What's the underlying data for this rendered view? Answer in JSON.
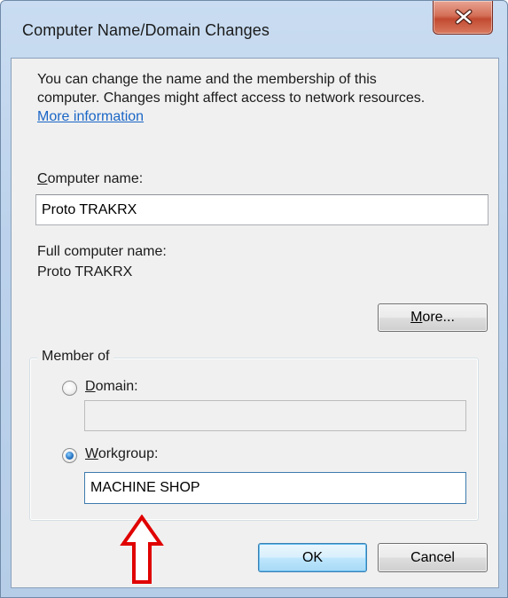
{
  "window": {
    "title": "Computer Name/Domain Changes",
    "close_glyph": "close-icon"
  },
  "intro": {
    "line1": "You can change the name and the membership of this",
    "line2": "computer. Changes might affect access to network resources.",
    "more_info_link": "More information"
  },
  "computer_name": {
    "label_accel": "C",
    "label_rest": "omputer name:",
    "value": "Proto TRAKRX"
  },
  "full_name": {
    "label": "Full computer name:",
    "value": "Proto TRAKRX"
  },
  "more_button": {
    "accel": "M",
    "rest": "ore..."
  },
  "member_of": {
    "legend": "Member of",
    "domain": {
      "label_accel": "D",
      "label_rest": "omain:",
      "value": "",
      "selected": false
    },
    "workgroup": {
      "label_accel": "W",
      "label_rest": "orkgroup:",
      "value": "MACHINE SHOP",
      "selected": true
    }
  },
  "buttons": {
    "ok": "OK",
    "cancel": "Cancel"
  },
  "annotation": {
    "arrow_color": "#e00000",
    "arrow_icon": "up-arrow-icon"
  },
  "colors": {
    "link": "#1a66c6",
    "dialog_bg": "#f0f0f0",
    "frame": "#bcd2ec"
  }
}
